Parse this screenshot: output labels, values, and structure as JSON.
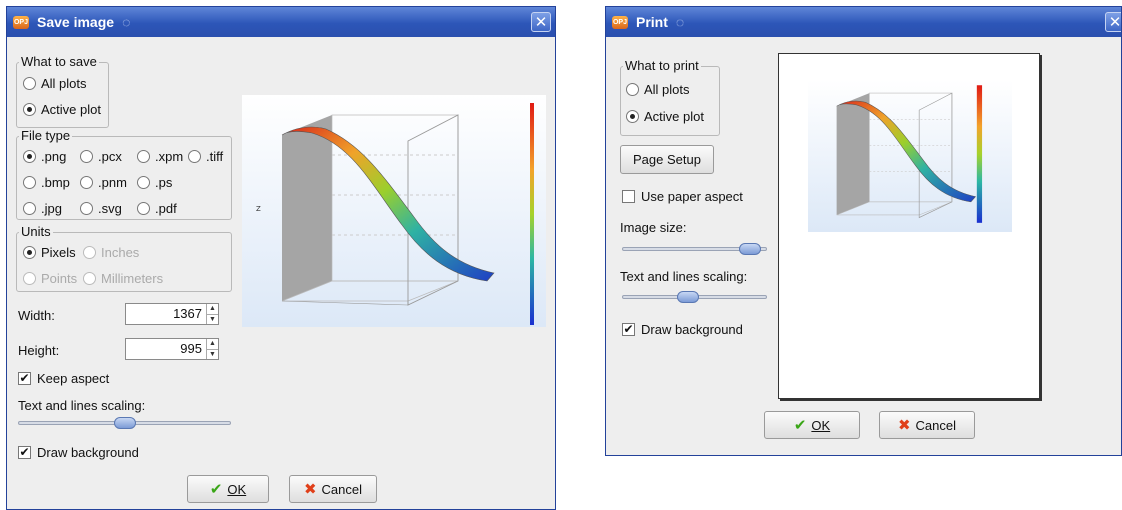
{
  "save_dialog": {
    "title": "Save image",
    "what_to_save": {
      "title": "What to save",
      "options": [
        "All plots",
        "Active plot"
      ],
      "selected": 1
    },
    "file_type": {
      "title": "File type",
      "options": [
        ".png",
        ".pcx",
        ".xpm",
        ".tiff",
        ".bmp",
        ".pnm",
        ".ps",
        ".jpg",
        ".svg",
        ".pdf"
      ],
      "selected": 0
    },
    "units": {
      "title": "Units",
      "options": [
        "Pixels",
        "Inches",
        "Points",
        "Millimeters"
      ],
      "selected": 0
    },
    "width_label": "Width:",
    "width_value": "1367",
    "height_label": "Height:",
    "height_value": "995",
    "keep_aspect_label": "Keep aspect",
    "keep_aspect_checked": true,
    "scaling_label": "Text and lines scaling:",
    "scaling_level": 0.5,
    "draw_background_label": "Draw background",
    "draw_background_checked": true,
    "ok_label": "OK",
    "cancel_label": "Cancel"
  },
  "print_dialog": {
    "title": "Print",
    "what_to_print": {
      "title": "What to print",
      "options": [
        "All plots",
        "Active plot"
      ],
      "selected": 1
    },
    "page_setup_label": "Page Setup",
    "use_paper_aspect_label": "Use paper aspect",
    "use_paper_aspect_checked": false,
    "image_size_label": "Image size:",
    "image_size_level": 0.95,
    "scaling_label": "Text and lines scaling:",
    "scaling_level": 0.45,
    "draw_background_label": "Draw background",
    "draw_background_checked": true,
    "ok_label": "OK",
    "cancel_label": "Cancel"
  },
  "icons": {
    "app": "origin-app-icon",
    "title_swirl": "swirl-icon",
    "close": "close-icon",
    "ok": "checkmark-icon",
    "cancel": "x-cancel-icon"
  },
  "colors": {
    "titlebar": "#2d56b8",
    "dialog_bg": "#eeeeee",
    "ok_check": "#3aa617",
    "cancel_x": "#e0401a"
  }
}
